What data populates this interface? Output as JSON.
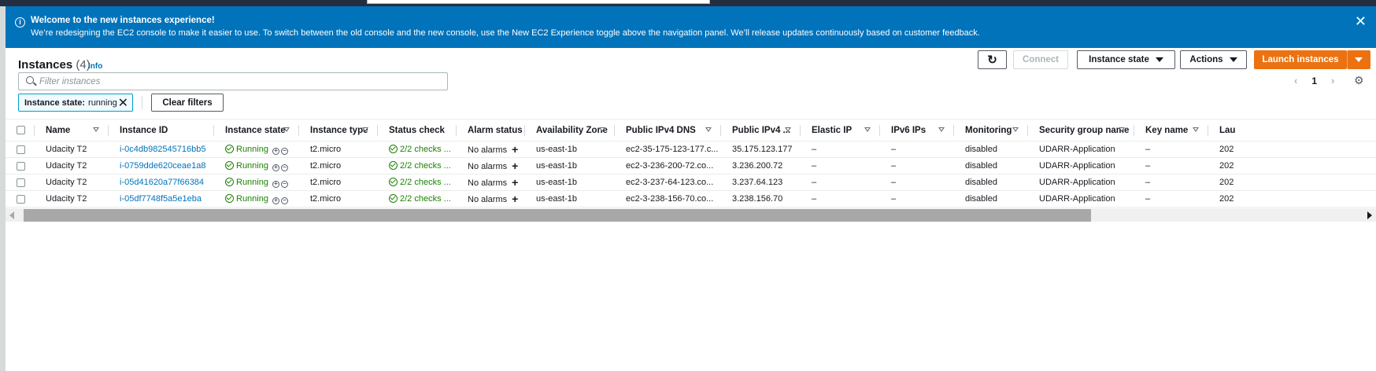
{
  "banner": {
    "title": "Welcome to the new instances experience!",
    "text": "We’re redesigning the EC2 console to make it easier to use. To switch between the old console and the new console, use the New EC2 Experience toggle above the navigation panel. We’ll release updates continuously based on customer feedback.",
    "close": "✕",
    "info_icon": "i",
    "color": "#0073bb"
  },
  "header": {
    "title": "Instances",
    "count": "(4)",
    "info": "Info"
  },
  "toolbar": {
    "refresh_icon": "↻",
    "connect": "Connect",
    "instance_state": "Instance state",
    "actions": "Actions",
    "launch": "Launch instances",
    "launch_color": "#ec7211"
  },
  "search": {
    "placeholder": "Filter instances"
  },
  "pagination": {
    "prev": "‹",
    "page": "1",
    "next": "›",
    "settings_icon": "⚙"
  },
  "filter_token": {
    "key": "Instance state:",
    "value": "running",
    "remove": "✕"
  },
  "clear_filters": "Clear filters",
  "table": {
    "columns": [
      "Name",
      "Instance ID",
      "Instance state",
      "Instance type",
      "Status check",
      "Alarm status",
      "Availability Zone",
      "Public IPv4 DNS",
      "Public IPv4 ...",
      "Elastic IP",
      "IPv6 IPs",
      "Monitoring",
      "Security group name",
      "Key name",
      "Lau"
    ],
    "rows": [
      {
        "name": "Udacity T2",
        "id": "i-0c4db982545716bb5",
        "state": "Running",
        "type": "t2.micro",
        "status": "2/2 checks ...",
        "alarm": "No alarms",
        "az": "us-east-1b",
        "dns": "ec2-35-175-123-177.c...",
        "ipv4": "35.175.123.177",
        "eip": "–",
        "ipv6": "–",
        "monitoring": "disabled",
        "sg": "UDARR-Application",
        "key": "–",
        "launch": "202"
      },
      {
        "name": "Udacity T2",
        "id": "i-0759dde620ceae1a8",
        "state": "Running",
        "type": "t2.micro",
        "status": "2/2 checks ...",
        "alarm": "No alarms",
        "az": "us-east-1b",
        "dns": "ec2-3-236-200-72.co...",
        "ipv4": "3.236.200.72",
        "eip": "–",
        "ipv6": "–",
        "monitoring": "disabled",
        "sg": "UDARR-Application",
        "key": "–",
        "launch": "202"
      },
      {
        "name": "Udacity T2",
        "id": "i-05d41620a77f66384",
        "state": "Running",
        "type": "t2.micro",
        "status": "2/2 checks ...",
        "alarm": "No alarms",
        "az": "us-east-1b",
        "dns": "ec2-3-237-64-123.co...",
        "ipv4": "3.237.64.123",
        "eip": "–",
        "ipv6": "–",
        "monitoring": "disabled",
        "sg": "UDARR-Application",
        "key": "–",
        "launch": "202"
      },
      {
        "name": "Udacity T2",
        "id": "i-05df7748f5a5e1eba",
        "state": "Running",
        "type": "t2.micro",
        "status": "2/2 checks ...",
        "alarm": "No alarms",
        "az": "us-east-1b",
        "dns": "ec2-3-238-156-70.co...",
        "ipv4": "3.238.156.70",
        "eip": "–",
        "ipv6": "–",
        "monitoring": "disabled",
        "sg": "UDARR-Application",
        "key": "–",
        "launch": "202"
      }
    ]
  }
}
